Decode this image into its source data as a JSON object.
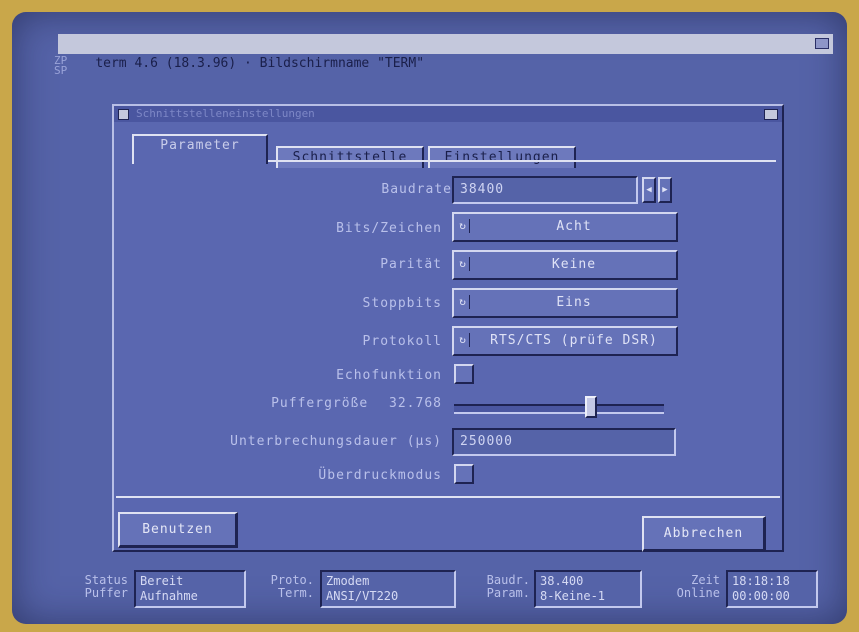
{
  "window": {
    "title": "term 4.6 (18.3.96) · Bildschirmname \"TERM\"",
    "screen_text": [
      "ZP",
      "SP"
    ]
  },
  "dialog": {
    "title": "Schnittstelleneinstellungen",
    "tabs": [
      {
        "label": "Parameter",
        "active": true
      },
      {
        "label": "Schnittstelle",
        "active": false
      },
      {
        "label": "Einstellungen",
        "active": false
      }
    ],
    "baudrate": {
      "label": "Baudrate",
      "value": "38400"
    },
    "bits": {
      "label": "Bits/Zeichen",
      "value": "Acht"
    },
    "paritaet": {
      "label": "Parität",
      "value": "Keine"
    },
    "stopbits": {
      "label": "Stoppbits",
      "value": "Eins"
    },
    "protokoll": {
      "label": "Protokoll",
      "value": "RTS/CTS (prüfe DSR)"
    },
    "echo": {
      "label": "Echofunktion",
      "checked": false
    },
    "puffer": {
      "label": "Puffergröße",
      "value": "32.768",
      "level": 0.65
    },
    "unterbrechung": {
      "label": "Unterbrechungsdauer (µs)",
      "value": "250000"
    },
    "ueberdruck": {
      "label": "Überdruckmodus",
      "checked": false
    },
    "buttons": {
      "use": "Benutzen",
      "cancel": "Abbrechen"
    }
  },
  "status": {
    "status_label": "Status",
    "puffer_label": "Puffer",
    "status_values": "Bereit\nAufnahme",
    "proto_label": "Proto.",
    "term_label": "Term.",
    "proto_values": "Zmodem\nANSI/VT220",
    "baud_label": "Baudr.",
    "param_label": "Param.",
    "baud_values": "38.400\n8-Keine-1",
    "zeit_label": "Zeit",
    "online_label": "Online",
    "zeit_values": "18:18:18\n00:00:00"
  },
  "colors": {
    "screen": "#5563a8",
    "dialog": "#5a67b0",
    "highlight": "#dfe2f2",
    "shadow": "#1e2352"
  }
}
